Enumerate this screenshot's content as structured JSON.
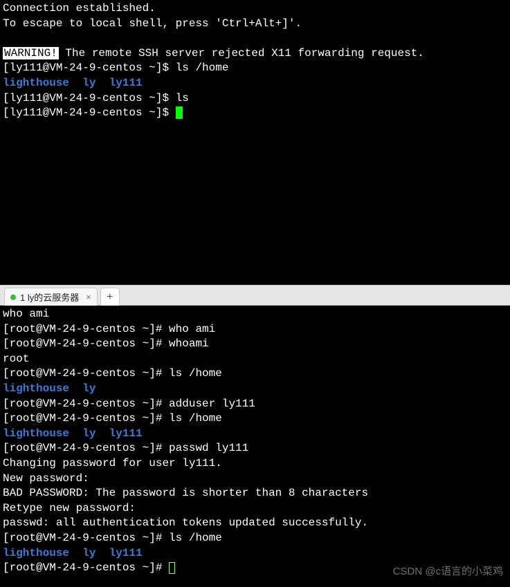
{
  "top_terminal": {
    "lines": [
      {
        "parts": [
          {
            "t": "Connection established."
          }
        ]
      },
      {
        "parts": [
          {
            "t": "To escape to local shell, press 'Ctrl+Alt+]'."
          }
        ]
      },
      {
        "parts": [
          {
            "t": ""
          }
        ]
      },
      {
        "parts": [
          {
            "t": "WARNING!",
            "cls": "warn-badge"
          },
          {
            "t": " The remote SSH server rejected X11 forwarding request."
          }
        ]
      },
      {
        "parts": [
          {
            "t": "[ly111@VM-24-9-centos ~]$ ls /home"
          }
        ]
      },
      {
        "parts": [
          {
            "t": "lighthouse  ly  ly111",
            "cls": "blue"
          }
        ]
      },
      {
        "parts": [
          {
            "t": "[ly111@VM-24-9-centos ~]$ ls"
          }
        ]
      },
      {
        "parts": [
          {
            "t": "[ly111@VM-24-9-centos ~]$ "
          },
          {
            "cursor": "green"
          }
        ]
      }
    ]
  },
  "tabbar": {
    "tab_label": "1 ly的云服务器",
    "status_color": "#2fbf3a"
  },
  "bottom_terminal": {
    "lines": [
      {
        "parts": [
          {
            "t": "who ami"
          }
        ]
      },
      {
        "parts": [
          {
            "t": "[root@VM-24-9-centos ~]# who ami"
          }
        ]
      },
      {
        "parts": [
          {
            "t": "[root@VM-24-9-centos ~]# whoami"
          }
        ]
      },
      {
        "parts": [
          {
            "t": "root"
          }
        ]
      },
      {
        "parts": [
          {
            "t": "[root@VM-24-9-centos ~]# ls /home"
          }
        ]
      },
      {
        "parts": [
          {
            "t": "lighthouse  ly",
            "cls": "blue"
          }
        ]
      },
      {
        "parts": [
          {
            "t": "[root@VM-24-9-centos ~]# adduser ly111"
          }
        ]
      },
      {
        "parts": [
          {
            "t": "[root@VM-24-9-centos ~]# ls /home"
          }
        ]
      },
      {
        "parts": [
          {
            "t": "lighthouse  ly  ly111",
            "cls": "blue"
          }
        ]
      },
      {
        "parts": [
          {
            "t": "[root@VM-24-9-centos ~]# passwd ly111"
          }
        ]
      },
      {
        "parts": [
          {
            "t": "Changing password for user ly111."
          }
        ]
      },
      {
        "parts": [
          {
            "t": "New password: "
          }
        ]
      },
      {
        "parts": [
          {
            "t": "BAD PASSWORD: The password is shorter than 8 characters"
          }
        ]
      },
      {
        "parts": [
          {
            "t": "Retype new password: "
          }
        ]
      },
      {
        "parts": [
          {
            "t": "passwd: all authentication tokens updated successfully."
          }
        ]
      },
      {
        "parts": [
          {
            "t": "[root@VM-24-9-centos ~]# ls /home"
          }
        ]
      },
      {
        "parts": [
          {
            "t": "lighthouse  ly  ly111",
            "cls": "blue"
          }
        ]
      },
      {
        "parts": [
          {
            "t": "[root@VM-24-9-centos ~]# "
          },
          {
            "cursor": "hollow"
          }
        ]
      }
    ]
  },
  "watermark": "CSDN @c语言的小菜鸡"
}
